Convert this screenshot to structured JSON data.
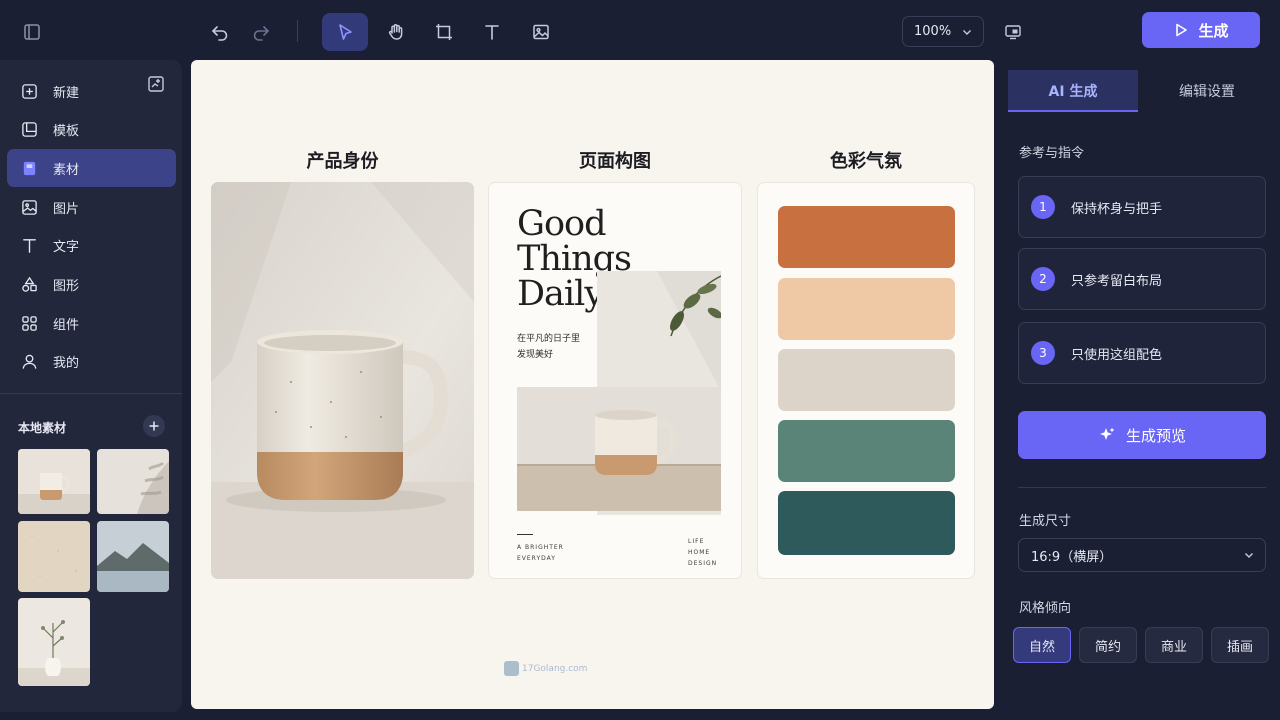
{
  "toolbar": {
    "zoom_value": "100%",
    "generate_label": "生成"
  },
  "sidebar": {
    "items": [
      {
        "label": "新建",
        "icon": "plus-square-icon"
      },
      {
        "label": "模板",
        "icon": "template-icon"
      },
      {
        "label": "素材",
        "icon": "assets-icon",
        "active": true
      },
      {
        "label": "图片",
        "icon": "image-icon"
      },
      {
        "label": "文字",
        "icon": "text-icon"
      },
      {
        "label": "图形",
        "icon": "shapes-icon"
      },
      {
        "label": "组件",
        "icon": "components-icon"
      },
      {
        "label": "我的",
        "icon": "user-icon"
      }
    ],
    "local_title": "本地素材"
  },
  "canvas": {
    "columns": [
      "产品身份",
      "页面构图",
      "色彩气氛"
    ],
    "layout_card": {
      "headline": [
        "Good",
        "Things",
        "Daily"
      ],
      "tagline": [
        "在平凡的日子里",
        "发现美好"
      ],
      "left_caption": [
        "A BRIGHTER",
        "EVERYDAY"
      ],
      "right_caption": [
        "LIFE",
        "HOME",
        "DESIGN"
      ]
    },
    "palette": [
      "#c8703f",
      "#efc8a6",
      "#ddd4c9",
      "#5b8479",
      "#2f5a5c"
    ]
  },
  "panel": {
    "tabs": [
      {
        "label": "AI 生成",
        "active": true
      },
      {
        "label": "编辑设置",
        "active": false
      }
    ],
    "ref_label": "参考与指令",
    "instructions": [
      {
        "num": "1",
        "text": "保持杯身与把手"
      },
      {
        "num": "2",
        "text": "只参考留白布局"
      },
      {
        "num": "3",
        "text": "只使用这组配色"
      }
    ],
    "preview_label": "生成预览",
    "size_label": "生成尺寸",
    "size_value": "16:9（横屏）",
    "style_label": "风格倾向",
    "styles": [
      {
        "label": "自然",
        "active": true
      },
      {
        "label": "简约",
        "active": false
      },
      {
        "label": "商业",
        "active": false
      },
      {
        "label": "插画",
        "active": false
      }
    ]
  },
  "watermark": "17Golang.com",
  "colors": {
    "accent": "#6a66f5",
    "background": "#1b1f33",
    "panel": "#22273b",
    "canvas": "#f8f5ef"
  }
}
